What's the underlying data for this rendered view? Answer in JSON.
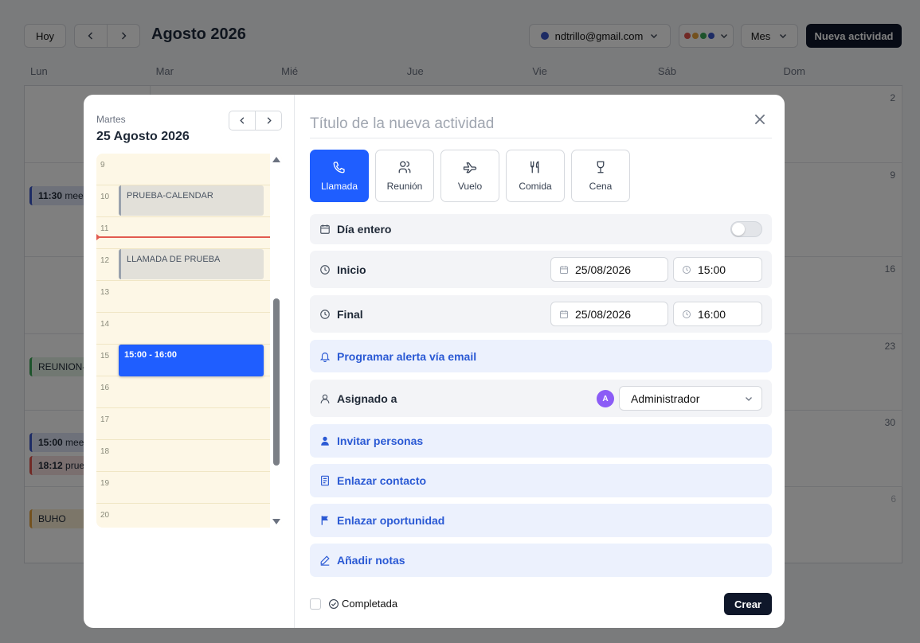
{
  "toolbar": {
    "today": "Hoy",
    "month_title": "Agosto 2026",
    "account_email": "ndtrillo@gmail.com",
    "view": "Mes",
    "new_activity": "Nueva actividad"
  },
  "weekdays": [
    "Lun",
    "Mar",
    "Mié",
    "Jue",
    "Vie",
    "Sáb",
    "Dom"
  ],
  "calendar_week_numbers": [
    "2",
    "9",
    "16",
    "23",
    "30",
    "6"
  ],
  "calendar_events": [
    {
      "time": "11:30",
      "text": "meet"
    },
    {
      "time": "",
      "text": "REUNION-S"
    },
    {
      "time": "15:00",
      "text": "mee"
    },
    {
      "time": "18:12",
      "text": "prue"
    },
    {
      "time": "",
      "text": "BUHO"
    }
  ],
  "modal": {
    "day_name": "Martes",
    "date": "25 Agosto 2026",
    "hours": [
      "9",
      "10",
      "11",
      "12",
      "13",
      "14",
      "15",
      "16",
      "17",
      "18",
      "19",
      "20"
    ],
    "timeline_events": [
      {
        "label": "PRUEBA-CALENDAR"
      },
      {
        "label": "LLAMADA DE PRUEBA"
      },
      {
        "label": "15:00 - 16:00"
      }
    ],
    "title_placeholder": "Título de la nueva actividad",
    "types": [
      {
        "label": "Llamada",
        "icon": "phone-icon"
      },
      {
        "label": "Reunión",
        "icon": "users-icon"
      },
      {
        "label": "Vuelo",
        "icon": "plane-icon"
      },
      {
        "label": "Comida",
        "icon": "utensils-icon"
      },
      {
        "label": "Cena",
        "icon": "wine-glass-icon"
      }
    ],
    "all_day_label": "Día entero",
    "start_label": "Inicio",
    "start_date": "25/08/2026",
    "start_time": "15:00",
    "end_label": "Final",
    "end_date": "25/08/2026",
    "end_time": "16:00",
    "email_alert": "Programar alerta vía email",
    "assigned_label": "Asignado a",
    "assigned_avatar": "A",
    "assigned_value": "Administrador",
    "invite": "Invitar personas",
    "link_contact": "Enlazar contacto",
    "link_opportunity": "Enlazar oportunidad",
    "add_notes": "Añadir notas",
    "completed_label": "Completada",
    "create_button": "Crear"
  },
  "colors": {
    "accent": "#1f5eff",
    "dark": "#0f172a",
    "link": "#2a59d4",
    "now_line": "#e25a4f",
    "timeline_bg": "#fdf7e6"
  }
}
